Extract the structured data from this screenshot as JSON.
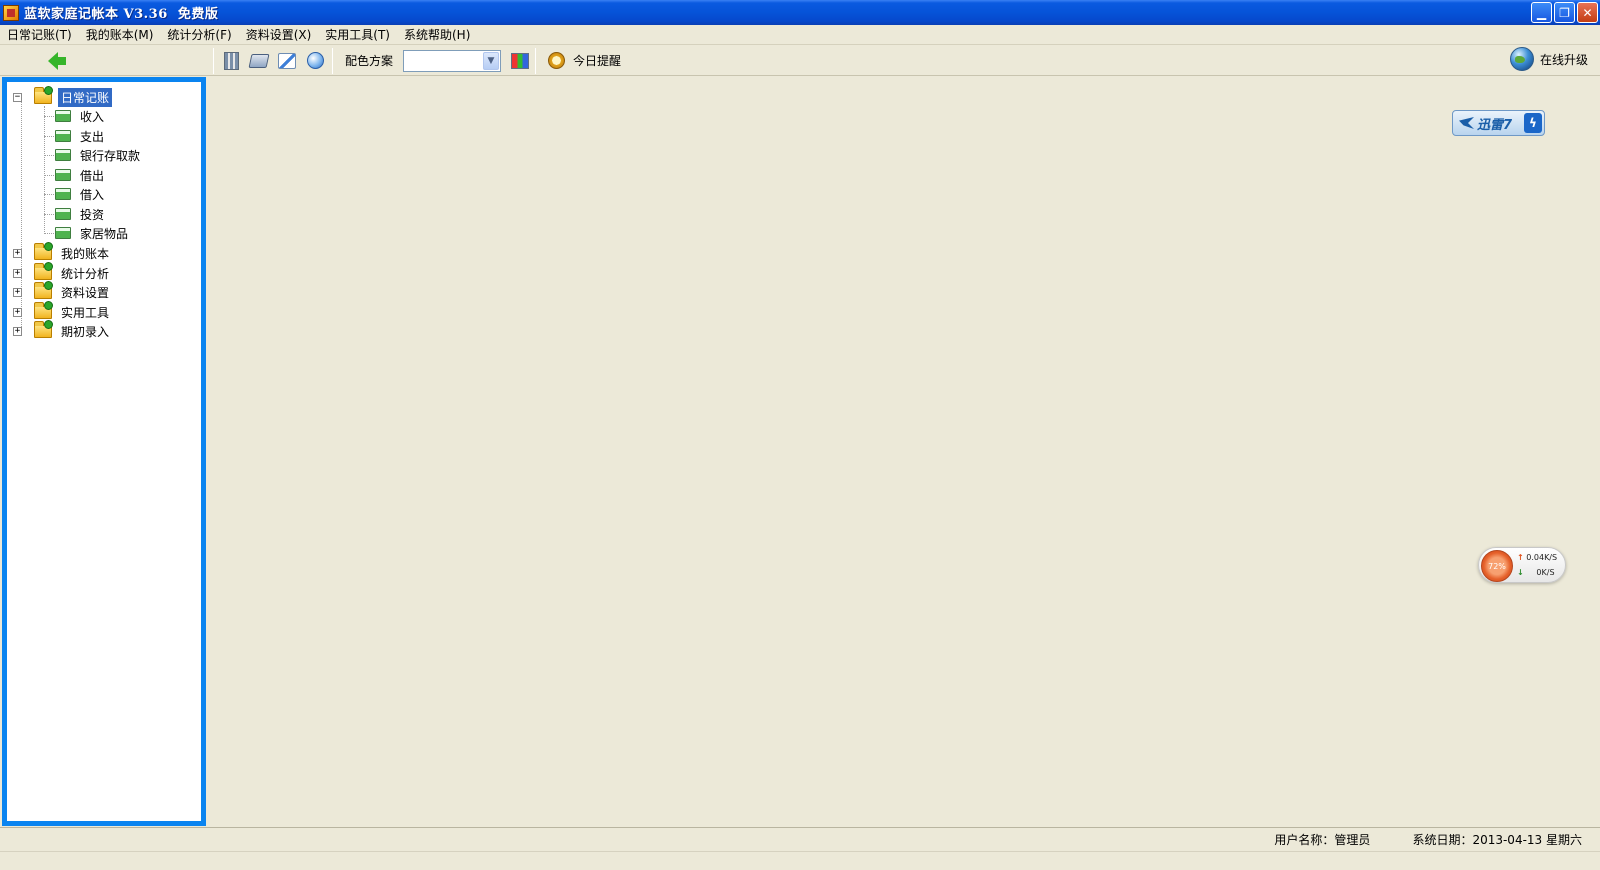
{
  "window": {
    "title": "蓝软家庭记帐本 V3.36  免费版",
    "controls": [
      "minimize",
      "restore",
      "close"
    ]
  },
  "menu": [
    {
      "label": "日常记账(T)"
    },
    {
      "label": "我的账本(M)"
    },
    {
      "label": "统计分析(F)"
    },
    {
      "label": "资料设置(X)"
    },
    {
      "label": "实用工具(T)"
    },
    {
      "label": "系统帮助(H)"
    }
  ],
  "toolbar": {
    "back_icon": "arrow-left-icon",
    "icons": [
      "calculator-icon",
      "print-icon",
      "edit-icon",
      "help-icon"
    ],
    "scheme_label": "配色方案",
    "scheme_value": "",
    "reminder_label": "今日提醒",
    "upgrade_label": "在线升级"
  },
  "tree": {
    "root": {
      "label": "日常记账",
      "expanded": true,
      "selected": true
    },
    "children": [
      "收入",
      "支出",
      "银行存取款",
      "借出",
      "借入",
      "投资",
      "家居物品"
    ],
    "collapsed": [
      "我的账本",
      "统计分析",
      "资料设置",
      "实用工具",
      "期初录入"
    ]
  },
  "overlays": {
    "xunlei_label": "迅雷7",
    "speed_percent": "72%",
    "speed_up": "0.04K/S",
    "speed_down": "0K/S"
  },
  "status": {
    "user": "用户名称：管理员",
    "date": "系统日期：2013-04-13  星期六"
  },
  "colors": {
    "titlebar": "#0653d8",
    "tree_frame": "#0a84f0",
    "selection": "#316ac5",
    "background": "#ece9d8"
  }
}
